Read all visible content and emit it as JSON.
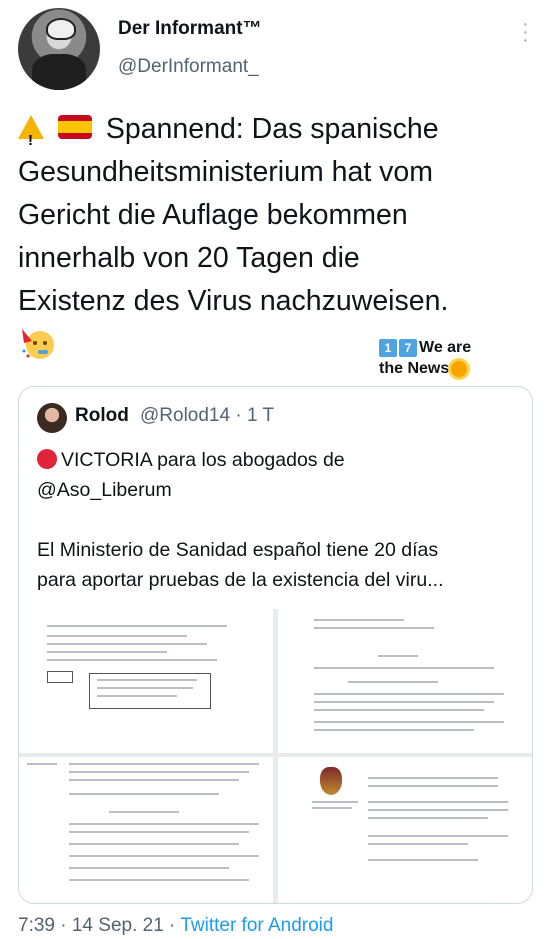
{
  "author": {
    "name": "Der Informant™",
    "handle": "@DerInformant_"
  },
  "tweet": {
    "lines": [
      "Spannend: Das spanische",
      "Gesundheitsministerium hat vom",
      "Gericht die Auflage bekommen",
      "innerhalb von 20 Tagen die",
      "Existenz des Virus nachzuweisen."
    ],
    "emoji_icons": [
      "warning-icon",
      "spain-flag-icon",
      "party-face-icon"
    ]
  },
  "watermark": {
    "digits": [
      "1",
      "7"
    ],
    "line1": "We are",
    "line2": "the News"
  },
  "quoted": {
    "name": "Rolod",
    "meta": "@Rolod14 · 1 T",
    "text_line1": "VICTORIA para los abogados de",
    "text_line2": "@Aso_Liberum",
    "body_line1": "El Ministerio de Sanidad español tiene 20 días",
    "body_line2": "para aportar pruebas de la existencia del viru..."
  },
  "footer": {
    "time": "7:39 · 14 Sep. 21 · ",
    "source": "Twitter for Android"
  },
  "colors": {
    "accent": "#1d9bf0",
    "muted": "#536471",
    "red_dot": "#e0243a"
  }
}
